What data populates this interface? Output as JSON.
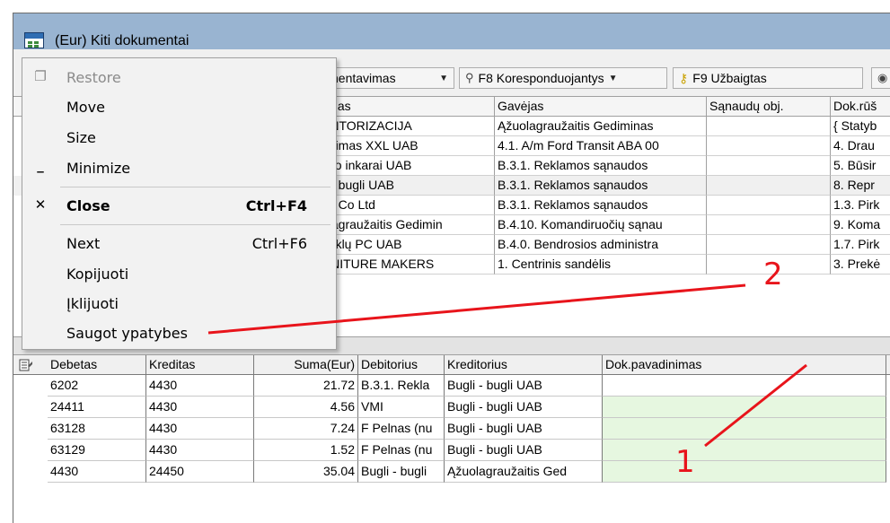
{
  "window": {
    "title": "(Eur) Kiti dokumentai"
  },
  "toolbar": {
    "btn1_label": "nentavimas",
    "btn2_label": "F8 Koresponduojantys",
    "btn3_label": "F9 Užbaigtas"
  },
  "grid_top": {
    "headers": [
      "itėjas",
      "Gavėjas",
      "Sąnaudų obj.",
      "Dok.rūš"
    ],
    "rows": [
      [
        "ENTORIZACIJA",
        "Ąžuolagraužaitis Gediminas",
        "",
        "{ Statyb"
      ],
      [
        "udimas XXL UAB",
        "4.1. A/m Ford Transit ABA 00",
        "",
        "4. Drau"
      ],
      [
        "yno inkarai UAB",
        "B.3.1. Reklamos sąnaudos",
        "",
        "5. Būsir"
      ],
      [
        "li - bugli UAB",
        "B.3.1. Reklamos sąnaudos",
        "",
        "8. Repr"
      ],
      [
        "se Co Ltd",
        "B.3.1. Reklamos sąnaudos",
        "",
        "1.3. Pirk"
      ],
      [
        "olagraužaitis Gedimin",
        "B.4.10. Komandiruočių sąnau",
        "",
        "9. Koma"
      ],
      [
        "ouklų PC UAB",
        "B.4.0. Bendrosios administra",
        "",
        "1.7. Pirk"
      ],
      [
        "RNITURE MAKERS",
        "1. Centrinis sandėlis",
        "",
        "3. Prekė"
      ]
    ]
  },
  "grid_bottom": {
    "headers": [
      "Debetas",
      "Kreditas",
      "Suma(Eur)",
      "Debitorius",
      "Kreditorius",
      "Dok.pavadinimas"
    ],
    "rows": [
      [
        "6202",
        "4430",
        "21.72",
        "B.3.1. Rekla",
        "Bugli - bugli UAB",
        ""
      ],
      [
        "24411",
        "4430",
        "4.56",
        "VMI",
        "Bugli - bugli UAB",
        ""
      ],
      [
        "63128",
        "4430",
        "7.24",
        "F Pelnas (nu",
        "Bugli - bugli UAB",
        ""
      ],
      [
        "63129",
        "4430",
        "1.52",
        "F Pelnas (nu",
        "Bugli - bugli UAB",
        ""
      ],
      [
        "4430",
        "24450",
        "35.04",
        "Bugli - bugli",
        "Ąžuolagraužaitis Ged",
        ""
      ]
    ]
  },
  "menu": {
    "restore": "Restore",
    "move": "Move",
    "size": "Size",
    "minimize": "Minimize",
    "close": "Close",
    "close_shortcut": "Ctrl+F4",
    "next": "Next",
    "next_shortcut": "Ctrl+F6",
    "kopijuoti": "Kopijuoti",
    "iklijuoti": "Įklijuoti",
    "saugot": "Saugot ypatybes"
  },
  "annotations": {
    "one": "1",
    "two": "2"
  },
  "colors": {
    "titlebar": "#99b4d1",
    "annotation": "#e8141b",
    "highlight": "#e6f7e0"
  }
}
